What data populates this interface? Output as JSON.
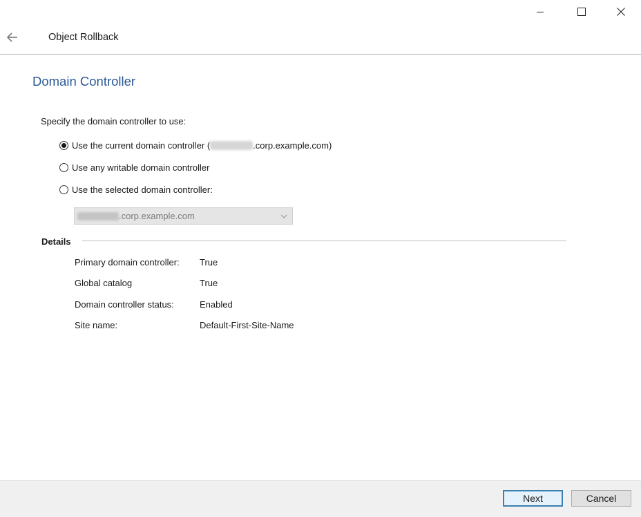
{
  "window": {
    "minimize_icon": "minimize-icon",
    "maximize_icon": "maximize-icon",
    "close_icon": "close-icon"
  },
  "header": {
    "back_icon": "arrow-left-icon",
    "title": "Object Rollback"
  },
  "page": {
    "title": "Domain Controller",
    "prompt": "Specify the domain controller to use:"
  },
  "options": [
    {
      "label_prefix": "Use the current domain controller (",
      "label_suffix": ".corp.example.com)",
      "selected": true
    },
    {
      "label": "Use any writable domain controller",
      "selected": false
    },
    {
      "label": "Use the selected domain controller:",
      "selected": false
    }
  ],
  "dc_select": {
    "value_suffix": ".corp.example.com",
    "disabled": true,
    "icon": "chevron-down-icon"
  },
  "details": {
    "heading": "Details",
    "rows": [
      {
        "label": "Primary domain controller:",
        "value": "True"
      },
      {
        "label": "Global catalog",
        "value": "True"
      },
      {
        "label": "Domain controller status:",
        "value": "Enabled"
      },
      {
        "label": "Site name:",
        "value": "Default-First-Site-Name"
      }
    ]
  },
  "footer": {
    "next_label": "Next",
    "cancel_label": "Cancel"
  },
  "colors": {
    "accent_title": "#2b5797",
    "primary_button_border": "#3c7fb1"
  }
}
